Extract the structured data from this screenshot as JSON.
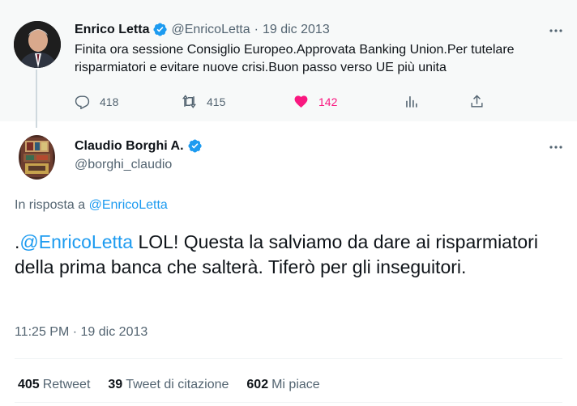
{
  "parent_tweet": {
    "author_name": "Enrico Letta",
    "handle": "@EnricoLetta",
    "separator": "·",
    "date": "19 dic 2013",
    "text": "Finita ora sessione Consiglio Europeo.Approvata Banking Union.Per tutelare risparmiatori e evitare nuove crisi.Buon passo verso UE più unita",
    "actions": {
      "replies": "418",
      "retweets": "415",
      "likes": "142"
    },
    "like_color": "#f91880"
  },
  "main_tweet": {
    "author_name": "Claudio Borghi A.",
    "handle": "@borghi_claudio",
    "reply_prefix": "In risposta a",
    "reply_mention": "@EnricoLetta",
    "text_prefix": ".",
    "text_mention": "@EnricoLetta",
    "text_body": " LOL! Questa la salviamo da dare ai risparmiatori della prima banca che salterà. Tiferò per gli inseguitori.",
    "time": "11:25 PM",
    "separator": "·",
    "date": "19 dic 2013",
    "stats": {
      "retweets_count": "405",
      "retweets_label": "Retweet",
      "quotes_count": "39",
      "quotes_label": "Tweet di citazione",
      "likes_count": "602",
      "likes_label": "Mi piace"
    }
  },
  "colors": {
    "accent": "#1d9bf0",
    "muted_text": "#536471",
    "text": "#0f1419"
  }
}
